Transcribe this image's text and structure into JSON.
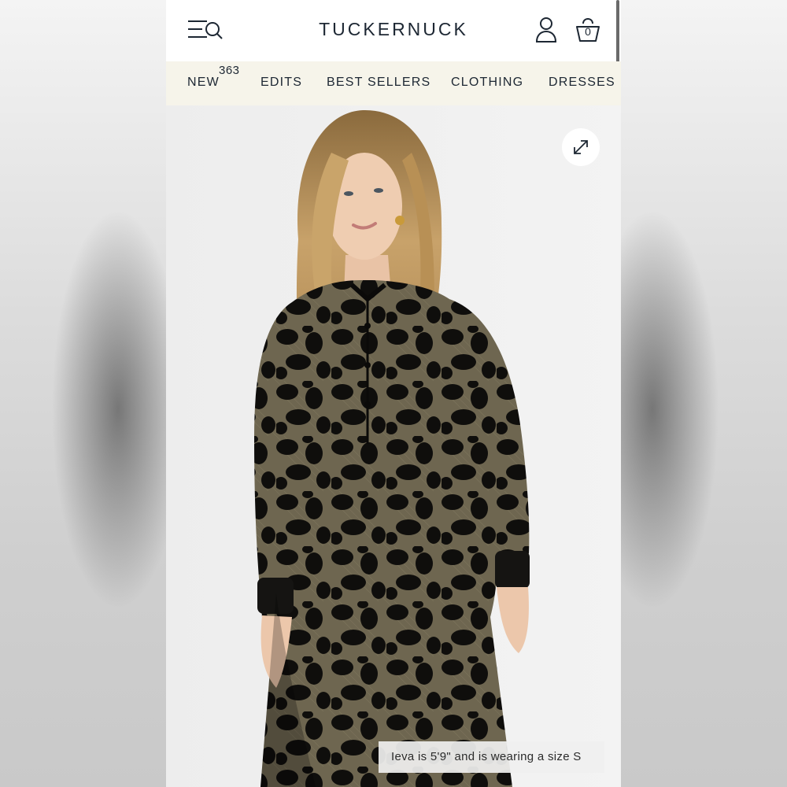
{
  "header": {
    "brand": "TUCKERNUCK",
    "bag_count": "0",
    "icons": {
      "menu": "menu-search-icon",
      "account": "account-icon",
      "bag": "shopping-bag-icon"
    }
  },
  "nav": {
    "items": [
      {
        "label": "NEW",
        "badge": "363"
      },
      {
        "label": "EDITS"
      },
      {
        "label": "BEST SELLERS"
      },
      {
        "label": "CLOTHING"
      },
      {
        "label": "DRESSES"
      }
    ]
  },
  "product": {
    "image_description": "Model in black and gold leopard print velvet shirt dress",
    "expand_icon": "expand-icon",
    "caption": "Ieva is 5'9\" and is wearing a size S"
  },
  "colors": {
    "nav_background": "#f6f4ea",
    "text_dark": "#1d2733",
    "dress_black": "#0f0e0c",
    "dress_gold": "#6e6650"
  }
}
